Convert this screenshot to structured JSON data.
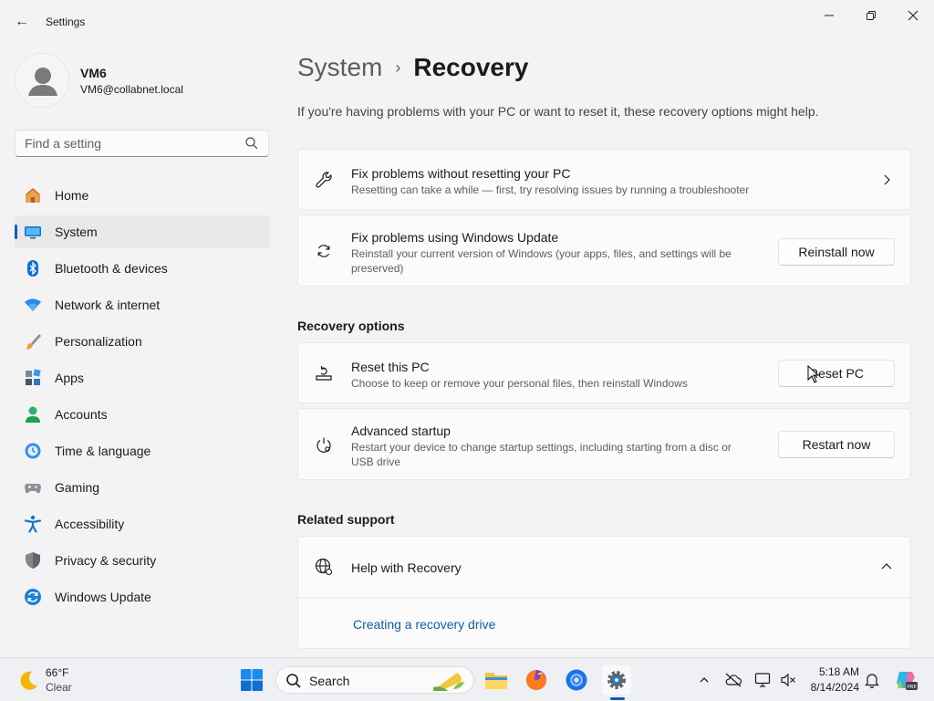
{
  "window": {
    "title": "Settings",
    "back_glyph": "←",
    "controls": [
      "minimize",
      "maximize",
      "close"
    ]
  },
  "profile": {
    "name": "VM6",
    "email": "VM6@collabnet.local"
  },
  "search": {
    "placeholder": "Find a setting",
    "value": ""
  },
  "nav": [
    {
      "label": "Home",
      "icon": "home-icon",
      "active": false
    },
    {
      "label": "System",
      "icon": "system-icon",
      "active": true
    },
    {
      "label": "Bluetooth & devices",
      "icon": "bluetooth-icon",
      "active": false
    },
    {
      "label": "Network & internet",
      "icon": "wifi-icon",
      "active": false
    },
    {
      "label": "Personalization",
      "icon": "brush-icon",
      "active": false
    },
    {
      "label": "Apps",
      "icon": "apps-icon",
      "active": false
    },
    {
      "label": "Accounts",
      "icon": "accounts-icon",
      "active": false
    },
    {
      "label": "Time & language",
      "icon": "clock-globe-icon",
      "active": false
    },
    {
      "label": "Gaming",
      "icon": "gamepad-icon",
      "active": false
    },
    {
      "label": "Accessibility",
      "icon": "accessibility-icon",
      "active": false
    },
    {
      "label": "Privacy & security",
      "icon": "shield-icon",
      "active": false
    },
    {
      "label": "Windows Update",
      "icon": "update-icon",
      "active": false
    }
  ],
  "page": {
    "breadcrumb_parent": "System",
    "breadcrumb_separator": "›",
    "breadcrumb_current": "Recovery",
    "intro": "If you're having problems with your PC or want to reset it, these recovery options might help."
  },
  "cards": {
    "fix_no_reset": {
      "title": "Fix problems without resetting your PC",
      "desc": "Resetting can take a while — first, try resolving issues by running a troubleshooter"
    },
    "fix_update": {
      "title": "Fix problems using Windows Update",
      "desc": "Reinstall your current version of Windows (your apps, files, and settings will be preserved)",
      "button": "Reinstall now"
    }
  },
  "recovery_options": {
    "heading": "Recovery options",
    "reset": {
      "title": "Reset this PC",
      "desc": "Choose to keep or remove your personal files, then reinstall Windows",
      "button": "Reset PC"
    },
    "advanced": {
      "title": "Advanced startup",
      "desc": "Restart your device to change startup settings, including starting from a disc or USB drive",
      "button": "Restart now"
    }
  },
  "related_support": {
    "heading": "Related support",
    "help_title": "Help with Recovery",
    "link": "Creating a recovery drive"
  },
  "taskbar": {
    "weather_temp": "66°F",
    "weather_cond": "Clear",
    "search_label": "Search",
    "time": "5:18 AM",
    "date": "8/14/2024",
    "accent": "#005fb8"
  }
}
